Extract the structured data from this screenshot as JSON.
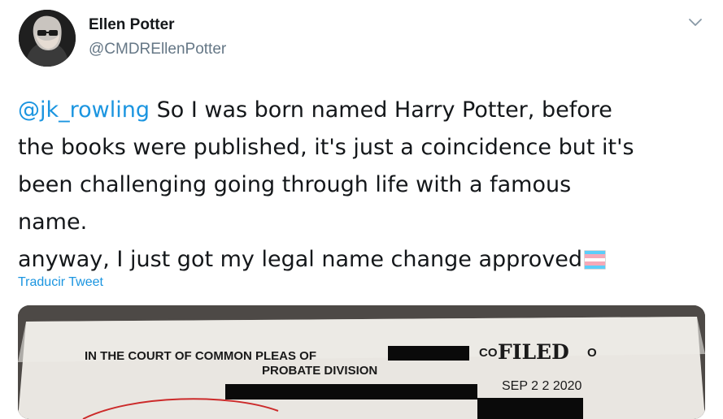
{
  "author": {
    "name": "Ellen Potter",
    "handle": "@CMDREllenPotter",
    "avatar_icon": "profile-photo"
  },
  "menu_icon": "chevron-down-icon",
  "tweet": {
    "mention": "@jk_rowling",
    "line1_rest": " So I was born named Harry Potter, before",
    "line2": "the books were published, it's just a coincidence but it's",
    "line3": "been challenging going through life with a famous",
    "line4": "name.",
    "line5": "anyway, I just got my legal name change approved",
    "emoji": "transgender-flag",
    "flag_colors": [
      "#5bcefa",
      "#f5a9b8",
      "#ffffff",
      "#f5a9b8",
      "#5bcefa"
    ]
  },
  "translate_label": "Traducir Tweet",
  "document": {
    "court_line": "IN THE COURT OF COMMON PLEAS OF",
    "division_line": "PROBATE DIVISION",
    "stamp_partial": "CO",
    "stamp_text": "FILED",
    "stamp_tail": "O",
    "stamp_date": "SEP 2 2 2020"
  },
  "colors": {
    "link": "#1b95e0",
    "text": "#14171a",
    "secondary": "#657786"
  }
}
